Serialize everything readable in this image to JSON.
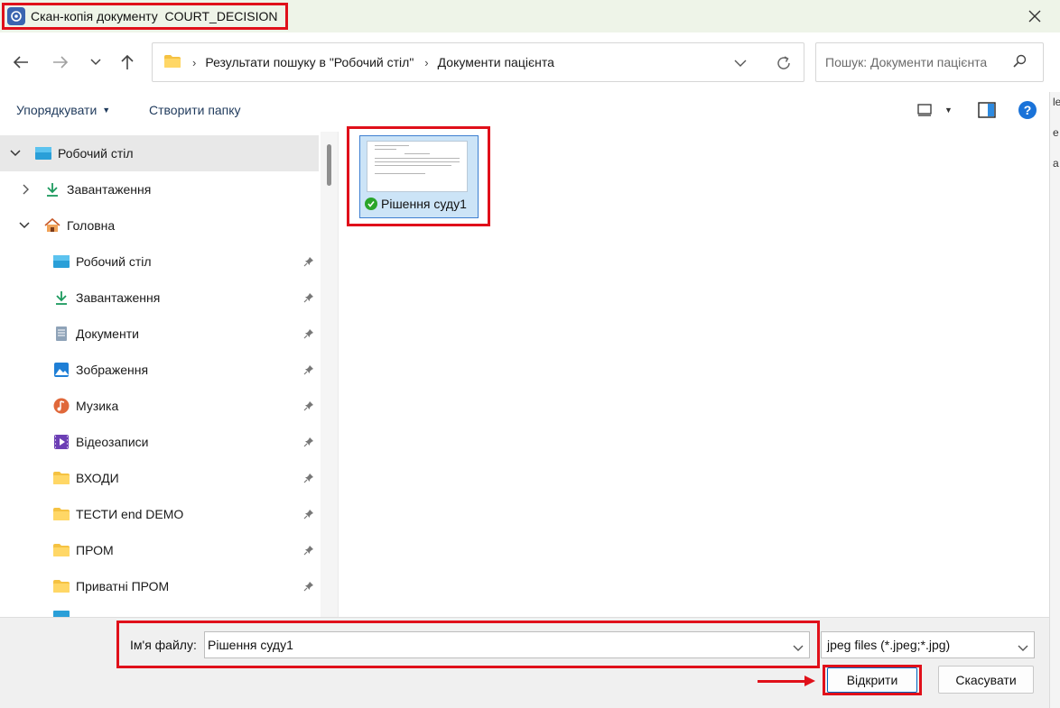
{
  "window": {
    "title": "Скан-копія документу  COURT_DECISION"
  },
  "breadcrumb": {
    "segments": [
      "Результати пошуку в \"Робочий стіл\"",
      "Документи пацієнта"
    ]
  },
  "search": {
    "placeholder": "Пошук: Документи пацієнта"
  },
  "toolbar": {
    "organize_label": "Упорядкувати",
    "new_folder_label": "Створити папку"
  },
  "sidebar": {
    "items": [
      {
        "label": "Робочий стіл",
        "icon": "desktop-icon",
        "pinned": false,
        "selected": true
      },
      {
        "label": "Завантаження",
        "icon": "download-icon",
        "pinned": false
      },
      {
        "label": "Головна",
        "icon": "home-icon",
        "pinned": false
      },
      {
        "label": "Робочий стіл",
        "icon": "desktop-icon",
        "pinned": true
      },
      {
        "label": "Завантаження",
        "icon": "download-icon",
        "pinned": true
      },
      {
        "label": "Документи",
        "icon": "documents-icon",
        "pinned": true
      },
      {
        "label": "Зображення",
        "icon": "pictures-icon",
        "pinned": true
      },
      {
        "label": "Музика",
        "icon": "music-icon",
        "pinned": true
      },
      {
        "label": "Відеозаписи",
        "icon": "videos-icon",
        "pinned": true
      },
      {
        "label": "ВХОДИ",
        "icon": "folder-icon",
        "pinned": true
      },
      {
        "label": "ТЕСТИ end DEMO",
        "icon": "folder-icon",
        "pinned": true
      },
      {
        "label": "ПРОМ",
        "icon": "folder-icon",
        "pinned": true
      },
      {
        "label": "Приватні ПРОМ",
        "icon": "folder-icon",
        "pinned": true
      }
    ]
  },
  "files": [
    {
      "name": "Рішення суду1",
      "status": "synced",
      "selected": true
    }
  ],
  "footer": {
    "filename_label": "Ім'я файлу:",
    "filename_value": "Рішення суду1",
    "filetype_value": "jpeg files (*.jpeg;*.jpg)",
    "open_label": "Відкрити",
    "cancel_label": "Скасувати"
  },
  "colors": {
    "highlight": "#e0101a",
    "accent": "#0067c0",
    "selection": "#cce4f7"
  }
}
